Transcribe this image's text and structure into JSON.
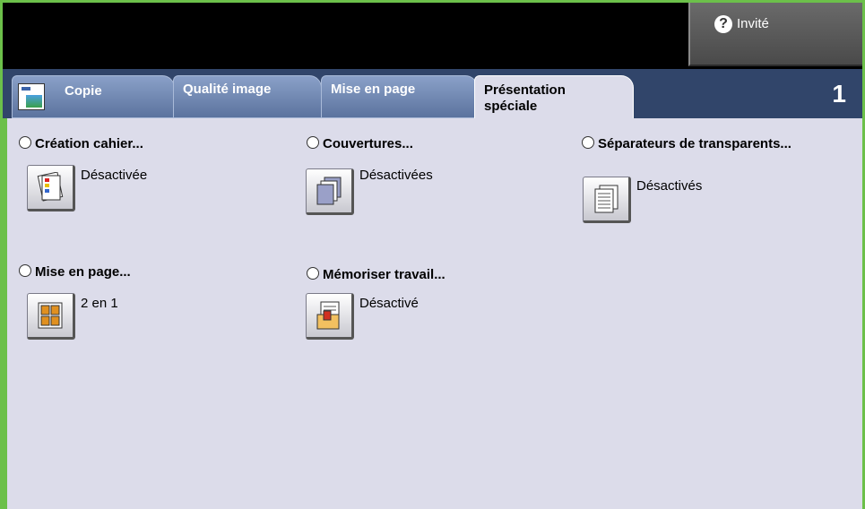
{
  "header": {
    "guest_label": "Invité",
    "help_icon": "question-icon"
  },
  "tabs": {
    "copy": "Copie",
    "quality": "Qualité image",
    "layout": "Mise en page",
    "special_line1": "Présentation",
    "special_line2": "spéciale",
    "quantity": "1"
  },
  "options": {
    "booklet": {
      "title": "Création cahier...",
      "status": "Désactivée",
      "icon": "booklet-icon"
    },
    "covers": {
      "title": "Couvertures...",
      "status": "Désactivées",
      "icon": "covers-icon"
    },
    "separators": {
      "title": "Séparateurs de transparents...",
      "status": "Désactivés",
      "icon": "transparency-separators-icon"
    },
    "page_layout": {
      "title": "Mise en page...",
      "status": "2 en 1",
      "icon": "pages-per-side-icon"
    },
    "store_job": {
      "title": "Mémoriser travail...",
      "status": "Désactivé",
      "icon": "store-job-icon"
    }
  },
  "colors": {
    "frame": "#6cc04a",
    "tab_bar": "#31456a",
    "panel": "#dcdcea"
  }
}
